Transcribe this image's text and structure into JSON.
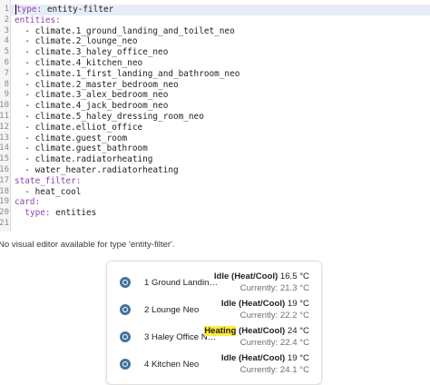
{
  "editor": {
    "line_numbers": [
      "1",
      "2",
      "3",
      "4",
      "5",
      "6",
      "7",
      "8",
      "9",
      "10",
      "11",
      "12",
      "13",
      "14",
      "15",
      "16",
      "17",
      "18",
      "19",
      "20",
      "21"
    ],
    "lines": [
      {
        "indent": "",
        "key": "type",
        "sep": ":",
        "value": " entity-filter"
      },
      {
        "indent": "",
        "key": "entities",
        "sep": ":",
        "value": ""
      },
      {
        "indent": "  ",
        "key": "",
        "sep": "",
        "value": "- climate.1_ground_landing_and_toilet_neo"
      },
      {
        "indent": "  ",
        "key": "",
        "sep": "",
        "value": "- climate.2_lounge_neo"
      },
      {
        "indent": "  ",
        "key": "",
        "sep": "",
        "value": "- climate.3_haley_office_neo"
      },
      {
        "indent": "  ",
        "key": "",
        "sep": "",
        "value": "- climate.4_kitchen_neo"
      },
      {
        "indent": "  ",
        "key": "",
        "sep": "",
        "value": "- climate.1_first_landing_and_bathroom_neo"
      },
      {
        "indent": "  ",
        "key": "",
        "sep": "",
        "value": "- climate.2_master_bedroom_neo"
      },
      {
        "indent": "  ",
        "key": "",
        "sep": "",
        "value": "- climate.3_alex_bedroom_neo"
      },
      {
        "indent": "  ",
        "key": "",
        "sep": "",
        "value": "- climate.4_jack_bedroom_neo"
      },
      {
        "indent": "  ",
        "key": "",
        "sep": "",
        "value": "- climate.5_haley_dressing_room_neo"
      },
      {
        "indent": "  ",
        "key": "",
        "sep": "",
        "value": "- climate.elliot_office"
      },
      {
        "indent": "  ",
        "key": "",
        "sep": "",
        "value": "- climate.guest_room"
      },
      {
        "indent": "  ",
        "key": "",
        "sep": "",
        "value": "- climate.guest_bathroom"
      },
      {
        "indent": "  ",
        "key": "",
        "sep": "",
        "value": "- climate.radiatorheating"
      },
      {
        "indent": "  ",
        "key": "",
        "sep": "",
        "value": "- water_heater.radiatorheating"
      },
      {
        "indent": "",
        "key": "state_filter",
        "sep": ":",
        "value": ""
      },
      {
        "indent": "  ",
        "key": "",
        "sep": "",
        "value": "- heat_cool"
      },
      {
        "indent": "",
        "key": "card",
        "sep": ":",
        "value": ""
      },
      {
        "indent": "  ",
        "key": "type",
        "sep": ":",
        "value": " entities"
      },
      {
        "indent": "",
        "key": "",
        "sep": "",
        "value": ""
      }
    ]
  },
  "notice": "No visual editor available for type 'entity-filter'.",
  "preview": {
    "rows": [
      {
        "name": "1 Ground Landing …",
        "mode": "Idle",
        "mode_highlight": false,
        "mode_suffix": " (Heat/Cool)",
        "target": "16.5 °C",
        "current": "Currently: 21.3 °C"
      },
      {
        "name": "2 Lounge Neo",
        "mode": "Idle",
        "mode_highlight": false,
        "mode_suffix": " (Heat/Cool)",
        "target": "19 °C",
        "current": "Currently: 22.2 °C"
      },
      {
        "name": "3 Haley Office N…",
        "mode": "Heating",
        "mode_highlight": true,
        "mode_suffix": " (Heat/Cool)",
        "target": "24 °C",
        "current": "Currently: 22.4 °C"
      },
      {
        "name": "4 Kitchen Neo",
        "mode": "Idle",
        "mode_highlight": false,
        "mode_suffix": " (Heat/Cool)",
        "target": "19 °C",
        "current": "Currently: 24.1 °C"
      }
    ],
    "icon_name": "thermostat-icon",
    "icon_color": "#44739e",
    "highlight_color": "#ffeb3b"
  }
}
